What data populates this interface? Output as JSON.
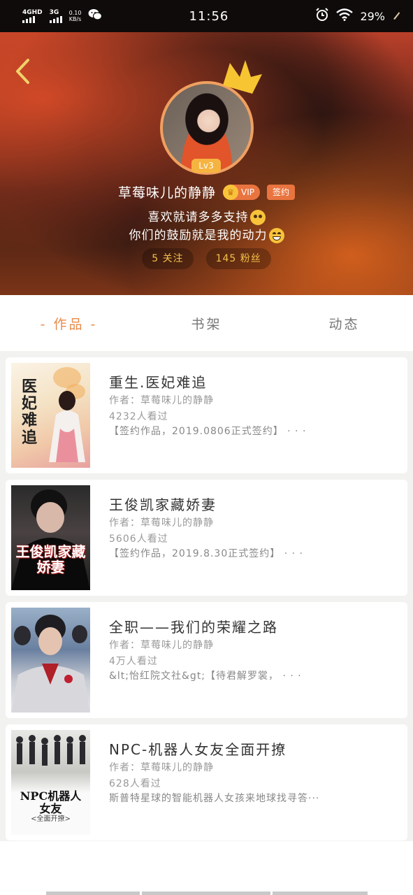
{
  "status_bar": {
    "network_1": "4GHD",
    "network_2": "3G",
    "speed_value": "0.10",
    "speed_unit": "KB/s",
    "time": "11:56",
    "battery": "29%",
    "icons": [
      "wechat-icon",
      "alarm-icon",
      "wifi-icon",
      "battery-icon"
    ]
  },
  "profile": {
    "back_icon": "back-chevron-icon",
    "level": "Lv3",
    "username": "草莓味儿的静静",
    "vip_label": "VIP",
    "sign_label": "签约",
    "bio_line1": "喜欢就请多多支持",
    "bio_line2": "你们的鼓励就是我的动力",
    "following": "5 关注",
    "followers": "145 粉丝"
  },
  "tabs": [
    {
      "label": "- 作品 -",
      "active": true
    },
    {
      "label": "书架",
      "active": false
    },
    {
      "label": "动态",
      "active": false
    }
  ],
  "books": [
    {
      "title": "重生.医妃难追",
      "author": "作者：草莓味儿的静静",
      "views": "4232人看过",
      "desc": "【签约作品，2019.0806正式签约】 · · ·",
      "cover_text": "医妃难追"
    },
    {
      "title": "王俊凯家藏娇妻",
      "author": "作者：草莓味儿的静静",
      "views": "5606人看过",
      "desc": "【签约作品，2019.8.30正式签约】 · · ·",
      "cover_text": "王俊凯家藏娇妻"
    },
    {
      "title": "全职——我们的荣耀之路",
      "author": "作者：草莓味儿的静静",
      "views": "4万人看过",
      "desc": "&lt;怡红院文社&gt;【待君解罗裳， · · ·"
    },
    {
      "title": "NPC-机器人女友全面开撩",
      "author": "作者：草莓味儿的静静",
      "views": "628人看过",
      "desc": "斯普特星球的智能机器人女孩来地球找寻答···",
      "cover_text": "NPC机器人女友",
      "cover_sub": "<全面开撩>"
    }
  ],
  "colors": {
    "accent": "#e98a4a",
    "gold": "#f2c14a",
    "badge": "#e9743f",
    "level": "#f5b441"
  }
}
